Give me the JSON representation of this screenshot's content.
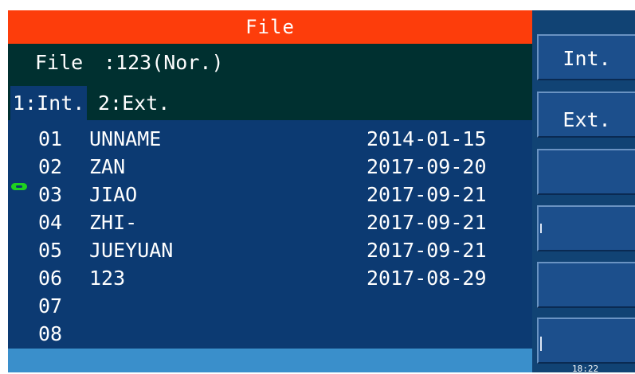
{
  "title": "File",
  "file": {
    "label": "File",
    "value": ":123(Nor.)"
  },
  "tabs": [
    {
      "label": "1:Int.",
      "active": true
    },
    {
      "label": "2:Ext.",
      "active": false
    }
  ],
  "files": [
    {
      "num": "01",
      "name": "UNNAME",
      "date": "2014-01-15"
    },
    {
      "num": "02",
      "name": "ZAN",
      "date": "2017-09-20"
    },
    {
      "num": "03",
      "name": "JIAO",
      "date": "2017-09-21"
    },
    {
      "num": "04",
      "name": "ZHI-",
      "date": "2017-09-21"
    },
    {
      "num": "05",
      "name": "JUEYUAN",
      "date": "2017-09-21"
    },
    {
      "num": "06",
      "name": "123",
      "date": "2017-08-29"
    },
    {
      "num": "07",
      "name": "",
      "date": ""
    },
    {
      "num": "08",
      "name": "",
      "date": ""
    }
  ],
  "soft_keys": [
    "Int.",
    "Ext.",
    "",
    "",
    "",
    ""
  ],
  "clock": "18:22",
  "colors": {
    "title_bar": "#fd3d0b",
    "header_bg": "#003030",
    "list_bg": "#0c3a72",
    "status_bar": "#3a8fcb",
    "cursor": "#1fd11f"
  }
}
